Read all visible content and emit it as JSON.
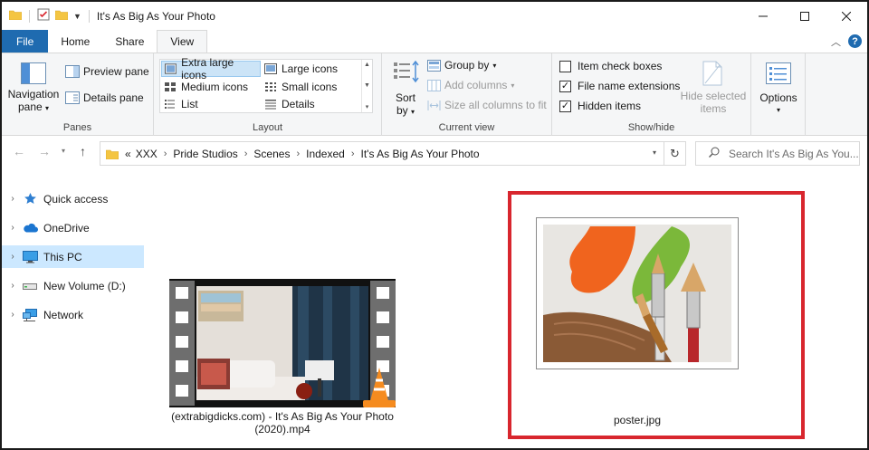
{
  "window": {
    "title": "It's As Big As Your Photo"
  },
  "tabs": {
    "file": "File",
    "home": "Home",
    "share": "Share",
    "view": "View"
  },
  "ribbon": {
    "panes": {
      "label": "Panes",
      "navigation_pane_line1": "Navigation",
      "navigation_pane_line2": "pane",
      "preview_pane": "Preview pane",
      "details_pane": "Details pane"
    },
    "layout": {
      "label": "Layout",
      "items": {
        "extra_large_icons": "Extra large icons",
        "large_icons": "Large icons",
        "medium_icons": "Medium icons",
        "small_icons": "Small icons",
        "list": "List",
        "details": "Details"
      },
      "selected": "Extra large icons"
    },
    "current_view": {
      "label": "Current view",
      "sort_by_line1": "Sort",
      "sort_by_line2": "by",
      "group_by": "Group by",
      "add_columns": "Add columns",
      "size_all_columns": "Size all columns to fit"
    },
    "show_hide": {
      "label": "Show/hide",
      "item_check_boxes": "Item check boxes",
      "item_check_boxes_checked": false,
      "file_name_extensions": "File name extensions",
      "file_name_extensions_checked": true,
      "hidden_items": "Hidden items",
      "hidden_items_checked": true,
      "hide_selected_line1": "Hide selected",
      "hide_selected_line2": "items"
    },
    "options": {
      "label": "Options"
    }
  },
  "address_bar": {
    "overflow": "«",
    "crumbs": [
      "XXX",
      "Pride Studios",
      "Scenes",
      "Indexed",
      "It's As Big As Your Photo"
    ]
  },
  "search": {
    "placeholder": "Search It's As Big As You..."
  },
  "nav_pane": {
    "items": [
      {
        "label": "Quick access",
        "icon": "star-icon"
      },
      {
        "label": "OneDrive",
        "icon": "cloud-icon"
      },
      {
        "label": "This PC",
        "icon": "computer-icon",
        "selected": true
      },
      {
        "label": "New Volume (D:)",
        "icon": "drive-icon"
      },
      {
        "label": "Network",
        "icon": "network-icon"
      }
    ]
  },
  "files": [
    {
      "name_line1": "(extrabigdicks.com) - It's As Big As Your Photo",
      "name_line2": "(2020).mp4",
      "type": "video"
    },
    {
      "name_line1": "poster.jpg",
      "type": "image",
      "highlighted": true
    }
  ],
  "colors": {
    "file_tab": "#1f6bb0",
    "selected_nav": "#cce8ff",
    "highlight_border": "#d8262e"
  }
}
